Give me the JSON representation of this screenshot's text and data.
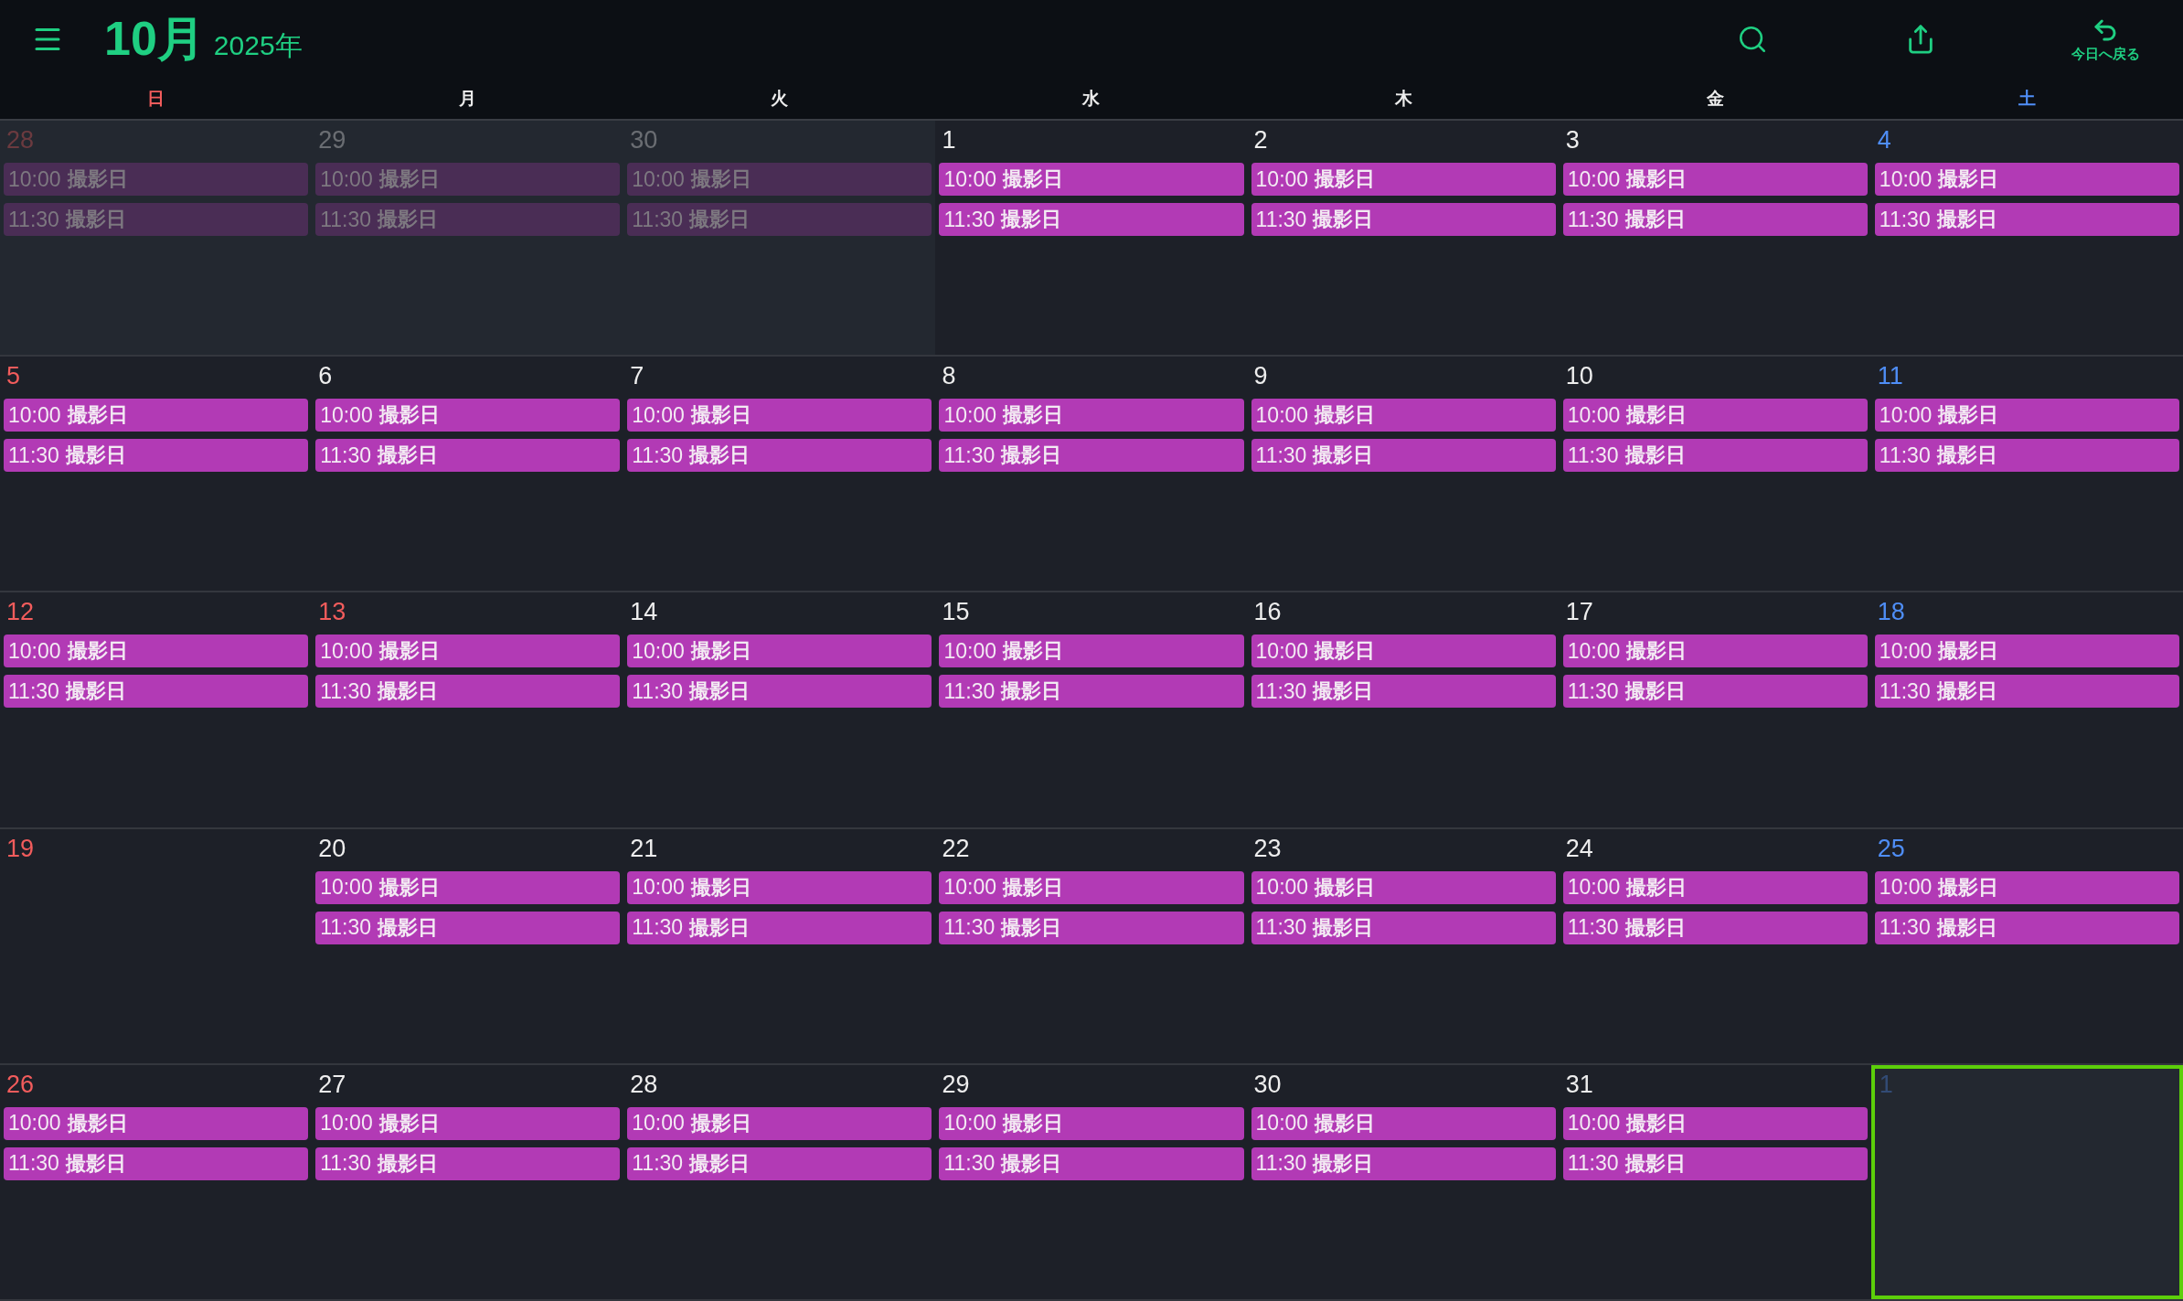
{
  "header": {
    "month": "10月",
    "year": "2025年",
    "today_button": "今日へ戻る"
  },
  "weekdays": [
    {
      "label": "日",
      "kind": "sunday"
    },
    {
      "label": "月",
      "kind": "weekday"
    },
    {
      "label": "火",
      "kind": "weekday"
    },
    {
      "label": "水",
      "kind": "weekday"
    },
    {
      "label": "木",
      "kind": "weekday"
    },
    {
      "label": "金",
      "kind": "weekday"
    },
    {
      "label": "土",
      "kind": "saturday"
    }
  ],
  "weeks": [
    [
      {
        "day": "28",
        "kind": "sunday",
        "outside": true,
        "selected": false,
        "events": [
          {
            "time": "10:00",
            "title": "撮影日"
          },
          {
            "time": "11:30",
            "title": "撮影日"
          }
        ]
      },
      {
        "day": "29",
        "kind": "weekday",
        "outside": true,
        "selected": false,
        "events": [
          {
            "time": "10:00",
            "title": "撮影日"
          },
          {
            "time": "11:30",
            "title": "撮影日"
          }
        ]
      },
      {
        "day": "30",
        "kind": "weekday",
        "outside": true,
        "selected": false,
        "events": [
          {
            "time": "10:00",
            "title": "撮影日"
          },
          {
            "time": "11:30",
            "title": "撮影日"
          }
        ]
      },
      {
        "day": "1",
        "kind": "weekday",
        "outside": false,
        "selected": false,
        "events": [
          {
            "time": "10:00",
            "title": "撮影日"
          },
          {
            "time": "11:30",
            "title": "撮影日"
          }
        ]
      },
      {
        "day": "2",
        "kind": "weekday",
        "outside": false,
        "selected": false,
        "events": [
          {
            "time": "10:00",
            "title": "撮影日"
          },
          {
            "time": "11:30",
            "title": "撮影日"
          }
        ]
      },
      {
        "day": "3",
        "kind": "weekday",
        "outside": false,
        "selected": false,
        "events": [
          {
            "time": "10:00",
            "title": "撮影日"
          },
          {
            "time": "11:30",
            "title": "撮影日"
          }
        ]
      },
      {
        "day": "4",
        "kind": "saturday",
        "outside": false,
        "selected": false,
        "events": [
          {
            "time": "10:00",
            "title": "撮影日"
          },
          {
            "time": "11:30",
            "title": "撮影日"
          }
        ]
      }
    ],
    [
      {
        "day": "5",
        "kind": "sunday",
        "outside": false,
        "selected": false,
        "events": [
          {
            "time": "10:00",
            "title": "撮影日"
          },
          {
            "time": "11:30",
            "title": "撮影日"
          }
        ]
      },
      {
        "day": "6",
        "kind": "weekday",
        "outside": false,
        "selected": false,
        "events": [
          {
            "time": "10:00",
            "title": "撮影日"
          },
          {
            "time": "11:30",
            "title": "撮影日"
          }
        ]
      },
      {
        "day": "7",
        "kind": "weekday",
        "outside": false,
        "selected": false,
        "events": [
          {
            "time": "10:00",
            "title": "撮影日"
          },
          {
            "time": "11:30",
            "title": "撮影日"
          }
        ]
      },
      {
        "day": "8",
        "kind": "weekday",
        "outside": false,
        "selected": false,
        "events": [
          {
            "time": "10:00",
            "title": "撮影日"
          },
          {
            "time": "11:30",
            "title": "撮影日"
          }
        ]
      },
      {
        "day": "9",
        "kind": "weekday",
        "outside": false,
        "selected": false,
        "events": [
          {
            "time": "10:00",
            "title": "撮影日"
          },
          {
            "time": "11:30",
            "title": "撮影日"
          }
        ]
      },
      {
        "day": "10",
        "kind": "weekday",
        "outside": false,
        "selected": false,
        "events": [
          {
            "time": "10:00",
            "title": "撮影日"
          },
          {
            "time": "11:30",
            "title": "撮影日"
          }
        ]
      },
      {
        "day": "11",
        "kind": "saturday",
        "outside": false,
        "selected": false,
        "events": [
          {
            "time": "10:00",
            "title": "撮影日"
          },
          {
            "time": "11:30",
            "title": "撮影日"
          }
        ]
      }
    ],
    [
      {
        "day": "12",
        "kind": "sunday",
        "outside": false,
        "selected": false,
        "events": [
          {
            "time": "10:00",
            "title": "撮影日"
          },
          {
            "time": "11:30",
            "title": "撮影日"
          }
        ]
      },
      {
        "day": "13",
        "kind": "holiday",
        "outside": false,
        "selected": false,
        "events": [
          {
            "time": "10:00",
            "title": "撮影日"
          },
          {
            "time": "11:30",
            "title": "撮影日"
          }
        ]
      },
      {
        "day": "14",
        "kind": "weekday",
        "outside": false,
        "selected": false,
        "events": [
          {
            "time": "10:00",
            "title": "撮影日"
          },
          {
            "time": "11:30",
            "title": "撮影日"
          }
        ]
      },
      {
        "day": "15",
        "kind": "weekday",
        "outside": false,
        "selected": false,
        "events": [
          {
            "time": "10:00",
            "title": "撮影日"
          },
          {
            "time": "11:30",
            "title": "撮影日"
          }
        ]
      },
      {
        "day": "16",
        "kind": "weekday",
        "outside": false,
        "selected": false,
        "events": [
          {
            "time": "10:00",
            "title": "撮影日"
          },
          {
            "time": "11:30",
            "title": "撮影日"
          }
        ]
      },
      {
        "day": "17",
        "kind": "weekday",
        "outside": false,
        "selected": false,
        "events": [
          {
            "time": "10:00",
            "title": "撮影日"
          },
          {
            "time": "11:30",
            "title": "撮影日"
          }
        ]
      },
      {
        "day": "18",
        "kind": "saturday",
        "outside": false,
        "selected": false,
        "events": [
          {
            "time": "10:00",
            "title": "撮影日"
          },
          {
            "time": "11:30",
            "title": "撮影日"
          }
        ]
      }
    ],
    [
      {
        "day": "19",
        "kind": "sunday",
        "outside": false,
        "selected": false
      },
      {
        "day": "20",
        "kind": "weekday",
        "outside": false,
        "selected": false,
        "events": [
          {
            "time": "10:00",
            "title": "撮影日"
          },
          {
            "time": "11:30",
            "title": "撮影日"
          }
        ]
      },
      {
        "day": "21",
        "kind": "weekday",
        "outside": false,
        "selected": false,
        "events": [
          {
            "time": "10:00",
            "title": "撮影日"
          },
          {
            "time": "11:30",
            "title": "撮影日"
          }
        ]
      },
      {
        "day": "22",
        "kind": "weekday",
        "outside": false,
        "selected": false,
        "events": [
          {
            "time": "10:00",
            "title": "撮影日"
          },
          {
            "time": "11:30",
            "title": "撮影日"
          }
        ]
      },
      {
        "day": "23",
        "kind": "weekday",
        "outside": false,
        "selected": false,
        "events": [
          {
            "time": "10:00",
            "title": "撮影日"
          },
          {
            "time": "11:30",
            "title": "撮影日"
          }
        ]
      },
      {
        "day": "24",
        "kind": "weekday",
        "outside": false,
        "selected": false,
        "events": [
          {
            "time": "10:00",
            "title": "撮影日"
          },
          {
            "time": "11:30",
            "title": "撮影日"
          }
        ]
      },
      {
        "day": "25",
        "kind": "saturday",
        "outside": false,
        "selected": false,
        "events": [
          {
            "time": "10:00",
            "title": "撮影日"
          },
          {
            "time": "11:30",
            "title": "撮影日"
          }
        ]
      }
    ],
    [
      {
        "day": "26",
        "kind": "sunday",
        "outside": false,
        "selected": false,
        "events": [
          {
            "time": "10:00",
            "title": "撮影日"
          },
          {
            "time": "11:30",
            "title": "撮影日"
          }
        ]
      },
      {
        "day": "27",
        "kind": "weekday",
        "outside": false,
        "selected": false,
        "events": [
          {
            "time": "10:00",
            "title": "撮影日"
          },
          {
            "time": "11:30",
            "title": "撮影日"
          }
        ]
      },
      {
        "day": "28",
        "kind": "weekday",
        "outside": false,
        "selected": false,
        "events": [
          {
            "time": "10:00",
            "title": "撮影日"
          },
          {
            "time": "11:30",
            "title": "撮影日"
          }
        ]
      },
      {
        "day": "29",
        "kind": "weekday",
        "outside": false,
        "selected": false,
        "events": [
          {
            "time": "10:00",
            "title": "撮影日"
          },
          {
            "time": "11:30",
            "title": "撮影日"
          }
        ]
      },
      {
        "day": "30",
        "kind": "weekday",
        "outside": false,
        "selected": false,
        "events": [
          {
            "time": "10:00",
            "title": "撮影日"
          },
          {
            "time": "11:30",
            "title": "撮影日"
          }
        ]
      },
      {
        "day": "31",
        "kind": "weekday",
        "outside": false,
        "selected": false,
        "events": [
          {
            "time": "10:00",
            "title": "撮影日"
          },
          {
            "time": "11:30",
            "title": "撮影日"
          }
        ]
      },
      {
        "day": "1",
        "kind": "saturday",
        "outside": true,
        "selected": true
      }
    ]
  ]
}
